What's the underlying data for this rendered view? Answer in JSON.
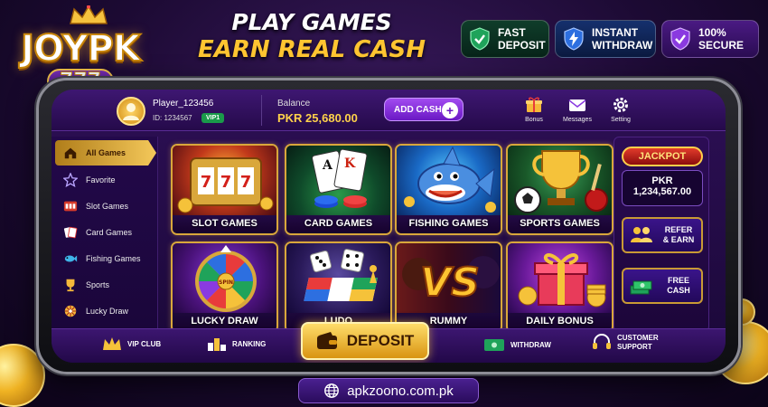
{
  "logo": {
    "main": "JOYPK",
    "sub": "777"
  },
  "headline": {
    "line1": "PLAY GAMES",
    "line2": "EARN REAL CASH"
  },
  "badges": [
    {
      "line1": "FAST",
      "line2": "DEPOSIT",
      "color": "#1fa35a"
    },
    {
      "line1": "INSTANT",
      "line2": "WITHDRAW",
      "color": "#2d6fe0"
    },
    {
      "line1": "100%",
      "line2": "SECURE",
      "color": "#8a3ae0"
    }
  ],
  "header": {
    "player_name": "Player_123456",
    "player_id": "ID: 1234567",
    "vip": "VIP1",
    "balance_label": "Balance",
    "balance_value": "PKR 25,680.00",
    "add_cash": "ADD CASH",
    "icons": [
      {
        "label": "Bonus",
        "icon": "gift-icon"
      },
      {
        "label": "Messages",
        "icon": "envelope-icon"
      },
      {
        "label": "Setting",
        "icon": "gear-icon"
      }
    ]
  },
  "sidebar": {
    "items": [
      {
        "label": "All Games",
        "icon": "home-icon",
        "active": true
      },
      {
        "label": "Favorite",
        "icon": "star-icon"
      },
      {
        "label": "Slot Games",
        "icon": "slot-icon"
      },
      {
        "label": "Card Games",
        "icon": "cards-icon"
      },
      {
        "label": "Fishing Games",
        "icon": "fish-icon"
      },
      {
        "label": "Sports",
        "icon": "trophy-icon"
      },
      {
        "label": "Lucky Draw",
        "icon": "wheel-icon"
      }
    ]
  },
  "games": [
    {
      "label": "SLOT GAMES"
    },
    {
      "label": "CARD GAMES"
    },
    {
      "label": "FISHING GAMES"
    },
    {
      "label": "SPORTS GAMES"
    },
    {
      "label": "LUCKY DRAW"
    },
    {
      "label": "LUDO"
    },
    {
      "label": "RUMMY"
    },
    {
      "label": "DAILY BONUS"
    }
  ],
  "jackpot": {
    "title": "JACKPOT",
    "currency": "PKR",
    "value": "1,234,567.00"
  },
  "right_buttons": [
    {
      "line1": "REFER",
      "line2": "& EARN"
    },
    {
      "line1": "FREE",
      "line2": "CASH"
    }
  ],
  "bottom_nav": {
    "vip_club": "VIP CLUB",
    "ranking": "RANKING",
    "deposit": "DEPOSIT",
    "withdraw": "WITHDRAW",
    "support_line1": "CUSTOMER",
    "support_line2": "SUPPORT"
  },
  "footer": {
    "url": "apkzoono.com.pk"
  }
}
